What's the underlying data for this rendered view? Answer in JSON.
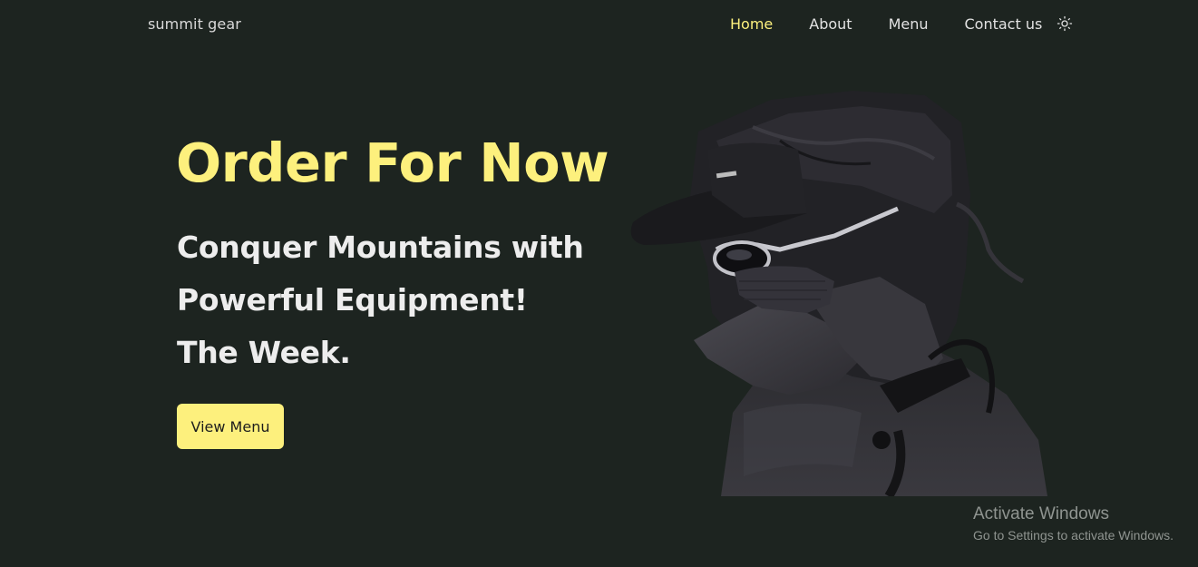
{
  "brand": "summit gear",
  "nav": {
    "items": [
      {
        "label": "Home",
        "active": true
      },
      {
        "label": "About",
        "active": false
      },
      {
        "label": "Menu",
        "active": false
      },
      {
        "label": "Contact us",
        "active": false
      }
    ],
    "theme_toggle_icon": "sun-icon"
  },
  "hero": {
    "title": "Order For Now",
    "subtitle_lines": [
      "Conquer Mountains with",
      "Powerful Equipment!",
      "The Week."
    ],
    "cta_label": "View Menu",
    "image_alt": "Person wearing black hooded jacket, cap, sunglasses and face mask"
  },
  "watermark": {
    "title": "Activate Windows",
    "subtitle": "Go to Settings to activate Windows."
  },
  "colors": {
    "background": "#1d2420",
    "accent": "#fdf07d",
    "text": "#ededed"
  }
}
